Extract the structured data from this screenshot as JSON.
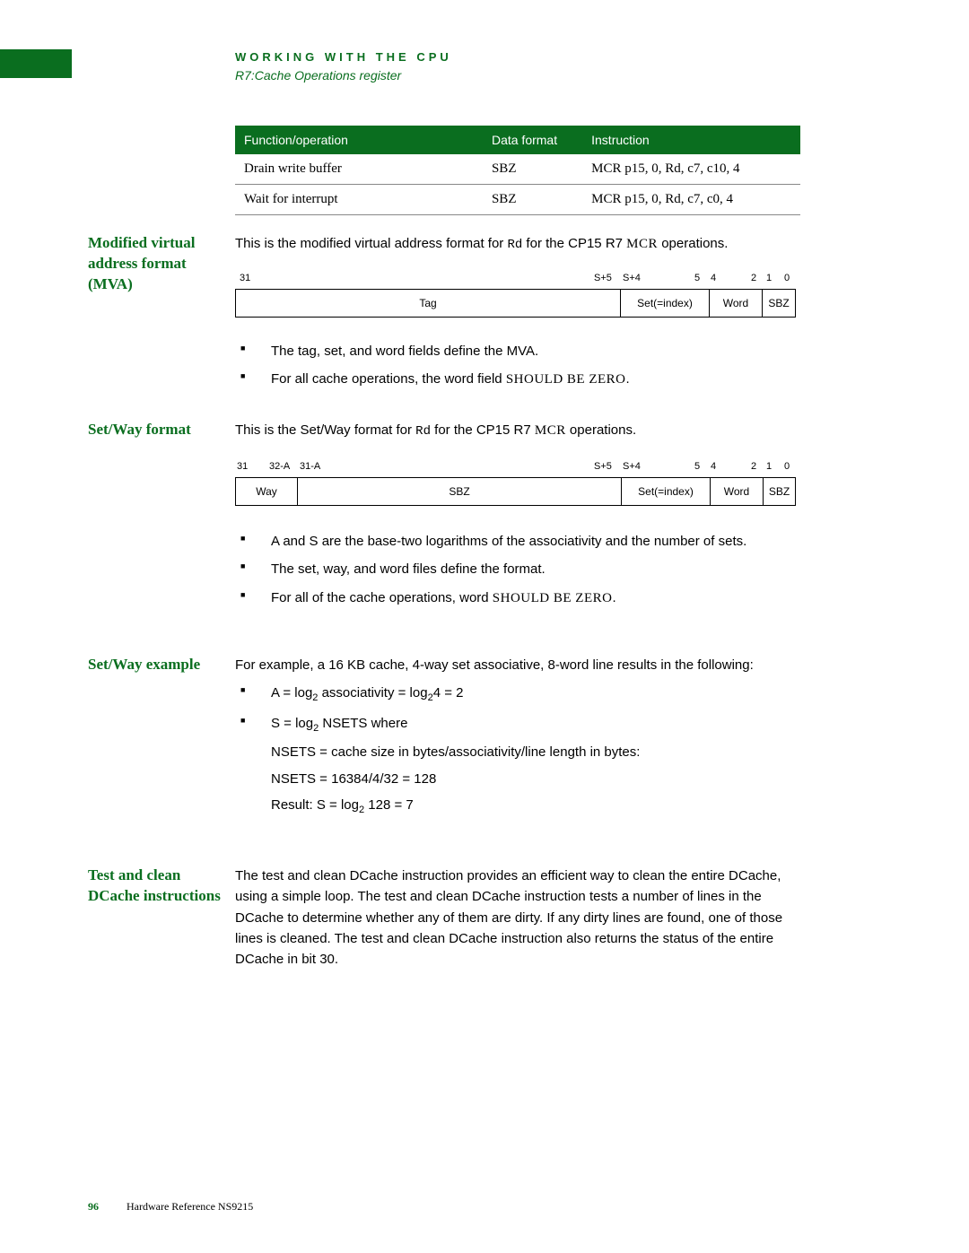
{
  "header": {
    "kicker": "WORKING WITH THE CPU",
    "sub": "R7:Cache Operations register"
  },
  "table": {
    "headers": [
      "Function/operation",
      "Data format",
      "Instruction"
    ],
    "rows": [
      [
        "Drain write buffer",
        "SBZ",
        "MCR p15, 0, Rd, c7, c10, 4"
      ],
      [
        "Wait for interrupt",
        "SBZ",
        "MCR p15, 0, Rd, c7, c0, 4"
      ]
    ]
  },
  "mva": {
    "label": "Modified virtual address format (MVA)",
    "intro_before": "This is the modified virtual address format for ",
    "intro_code": "Rd",
    "intro_mid": " for the CP15 R7 ",
    "intro_sc": "MCR",
    "intro_after": " operations.",
    "bits": {
      "labels": [
        "31",
        "S+5",
        "S+4",
        "5",
        "4",
        "2",
        "1",
        "0"
      ],
      "cells": [
        "Tag",
        "Set(=index)",
        "Word",
        "SBZ"
      ]
    },
    "bullets": [
      {
        "text": "The tag, set, and word fields define the MVA."
      },
      {
        "text_before": "For all cache operations, the word field ",
        "sc": "SHOULD BE ZERO",
        "text_after": "."
      }
    ]
  },
  "setway": {
    "label": "Set/Way format",
    "intro_before": "This is the Set/Way format for ",
    "intro_code": "Rd",
    "intro_mid": " for the CP15 R7 ",
    "intro_sc": "MCR",
    "intro_after": " operations.",
    "bits": {
      "labels": [
        "31",
        "32-A",
        "31-A",
        "S+5",
        "S+4",
        "5",
        "4",
        "2",
        "1",
        "0"
      ],
      "cells": [
        "Way",
        "SBZ",
        "Set(=index)",
        "Word",
        "SBZ"
      ]
    },
    "bullets": [
      {
        "text": "A and S are the base-two logarithms of the associativity and the number of sets."
      },
      {
        "text": "The set, way, and word files define the format."
      },
      {
        "text_before": "For all of the cache operations, word ",
        "sc": "SHOULD BE ZERO",
        "text_after": "."
      }
    ]
  },
  "example": {
    "label": "Set/Way example",
    "intro": "For example, a 16 KB cache, 4-way set associative, 8-word line results in the following:",
    "li1_a": "A = log",
    "li1_b": " associativity = log",
    "li1_c": "4 = 2",
    "li2_a": "S = log",
    "li2_b": " NSETS where",
    "sub2": "2",
    "nested1": "NSETS = cache size in bytes/associativity/line length in bytes:",
    "nested2": "NSETS = 16384/4/32 = 128",
    "nested3_a": "Result: S = log",
    "nested3_b": " 128 = 7"
  },
  "testclean": {
    "label": "Test and clean DCache instructions",
    "para": "The test and clean DCache instruction provides an efficient way to clean the entire DCache, using a simple loop. The test and clean DCache instruction tests a number of lines in the DCache to determine whether any of them are dirty. If any dirty lines are found, one of those lines is cleaned. The test and clean DCache instruction also returns the status of the entire DCache in bit 30."
  },
  "footer": {
    "page": "96",
    "title": "Hardware Reference NS9215"
  }
}
